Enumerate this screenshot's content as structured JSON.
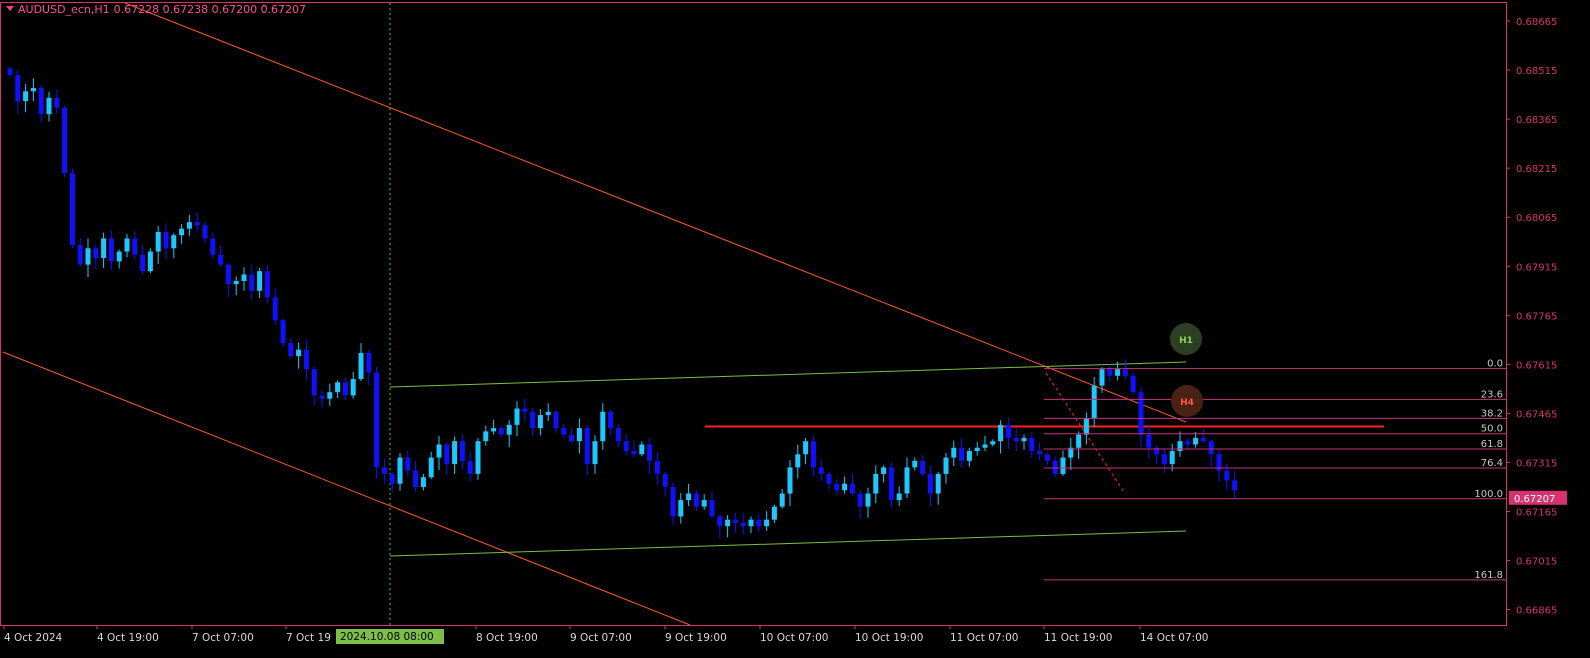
{
  "header": {
    "symbol": "AUDUSD_ecn,H1",
    "ohlc": "0.67228 0.67238 0.67200 0.67207"
  },
  "colors": {
    "background": "#000000",
    "border": "#d6326f",
    "bull_candle": "#1ec8ff",
    "bear_candle": "#1010ff",
    "trendline": "#ff5a1e",
    "channel": "#7dbe46",
    "level": "#ff2020",
    "fib": "#c8327d",
    "axis_text": "#d6326f",
    "crosshair": "#3cc850"
  },
  "chart_data": {
    "type": "candlestick",
    "symbol": "AUDUSD_ecn",
    "timeframe": "H1",
    "ylim": [
      0.66818,
      0.6872
    ],
    "y_ticks": [
      "0.68665",
      "0.68515",
      "0.68365",
      "0.68215",
      "0.68065",
      "0.67915",
      "0.67765",
      "0.67615",
      "0.67465",
      "0.67315",
      "0.67165",
      "0.67015",
      "0.66865"
    ],
    "x_ticks": [
      "4 Oct 2024",
      "4 Oct 19:00",
      "7 Oct 07:00",
      "7 Oct 19",
      "8 Oct 19:00",
      "9 Oct 07:00",
      "9 Oct 19:00",
      "10 Oct 07:00",
      "10 Oct 19:00",
      "11 Oct 07:00",
      "11 Oct 19:00",
      "14 Oct 07:00"
    ],
    "crosshair_date": "2024.10.08 08:00",
    "current_price": "0.67207",
    "closes": [
      0.685,
      0.6842,
      0.6845,
      0.6846,
      0.6838,
      0.6843,
      0.684,
      0.682,
      0.6798,
      0.6792,
      0.6797,
      0.6794,
      0.68,
      0.6793,
      0.6796,
      0.68,
      0.6795,
      0.679,
      0.6796,
      0.6802,
      0.6797,
      0.6801,
      0.6803,
      0.6805,
      0.6804,
      0.68,
      0.6795,
      0.6792,
      0.6786,
      0.6787,
      0.6789,
      0.6784,
      0.679,
      0.6782,
      0.6775,
      0.6768,
      0.6764,
      0.6766,
      0.676,
      0.6752,
      0.6751,
      0.6753,
      0.6756,
      0.6752,
      0.6757,
      0.6765,
      0.6759,
      0.673,
      0.6728,
      0.6725,
      0.6733,
      0.6729,
      0.6724,
      0.6727,
      0.6733,
      0.6737,
      0.6731,
      0.6738,
      0.6732,
      0.6728,
      0.6738,
      0.6741,
      0.6742,
      0.674,
      0.6743,
      0.6748,
      0.6747,
      0.6742,
      0.6746,
      0.6747,
      0.6742,
      0.674,
      0.6738,
      0.6742,
      0.6731,
      0.6738,
      0.6747,
      0.6742,
      0.6738,
      0.6735,
      0.6734,
      0.6737,
      0.6732,
      0.6728,
      0.6724,
      0.6715,
      0.672,
      0.6722,
      0.6718,
      0.672,
      0.6715,
      0.6712,
      0.6714,
      0.6713,
      0.6712,
      0.6714,
      0.6712,
      0.6714,
      0.6718,
      0.6722,
      0.673,
      0.6734,
      0.6738,
      0.673,
      0.6728,
      0.6725,
      0.6723,
      0.6725,
      0.6722,
      0.6718,
      0.6722,
      0.6728,
      0.673,
      0.672,
      0.6722,
      0.673,
      0.6732,
      0.6728,
      0.6722,
      0.6728,
      0.6733,
      0.6736,
      0.6732,
      0.6735,
      0.6736,
      0.6737,
      0.6738,
      0.6743,
      0.6739,
      0.6738,
      0.6739,
      0.6735,
      0.6734,
      0.6732,
      0.6728,
      0.6733,
      0.6736,
      0.674,
      0.6745,
      0.6755,
      0.676,
      0.6758,
      0.676,
      0.6758,
      0.6753,
      0.674,
      0.6736,
      0.6734,
      0.6731,
      0.6735,
      0.6738,
      0.6737,
      0.6739,
      0.6738,
      0.6734,
      0.6729,
      0.6726,
      0.6723
    ]
  },
  "levels": {
    "fib": [
      {
        "label": "0.0",
        "price": 0.67602
      },
      {
        "label": "23.6",
        "price": 0.67508
      },
      {
        "label": "38.2",
        "price": 0.6745
      },
      {
        "label": "50.0",
        "price": 0.67403
      },
      {
        "label": "61.8",
        "price": 0.67356
      },
      {
        "label": "76.4",
        "price": 0.67298
      },
      {
        "label": "100.0",
        "price": 0.67204
      },
      {
        "label": "161.8",
        "price": 0.66956
      }
    ],
    "resistance": 0.67425
  },
  "markers": {
    "h1": "H1",
    "h4": "H4"
  }
}
